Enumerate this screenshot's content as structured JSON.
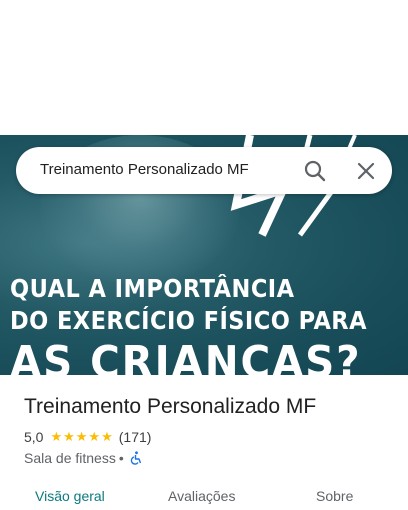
{
  "search": {
    "query": "Treinamento Personalizado MF",
    "search_icon": "search-icon",
    "close_icon": "close-icon"
  },
  "hero": {
    "line1": "QUAL A IMPORTÂNCIA",
    "line2": "DO EXERCÍCIO FÍSICO PARA",
    "line3": "AS CRIANÇAS?"
  },
  "place": {
    "name": "Treinamento Personalizado MF",
    "rating": "5,0",
    "stars": "★★★★★",
    "review_count": "(171)",
    "category": "Sala de fitness",
    "separator": "•",
    "accessibility_icon": "wheelchair-icon"
  },
  "tabs": [
    {
      "label": "Visão geral",
      "active": true
    },
    {
      "label": "Avaliações",
      "active": false
    },
    {
      "label": "Sobre",
      "active": false
    }
  ],
  "colors": {
    "hero_bg": "#1d5461",
    "star": "#fbbc04",
    "active_tab": "#0b7a80",
    "accessibility": "#1a73e8"
  }
}
